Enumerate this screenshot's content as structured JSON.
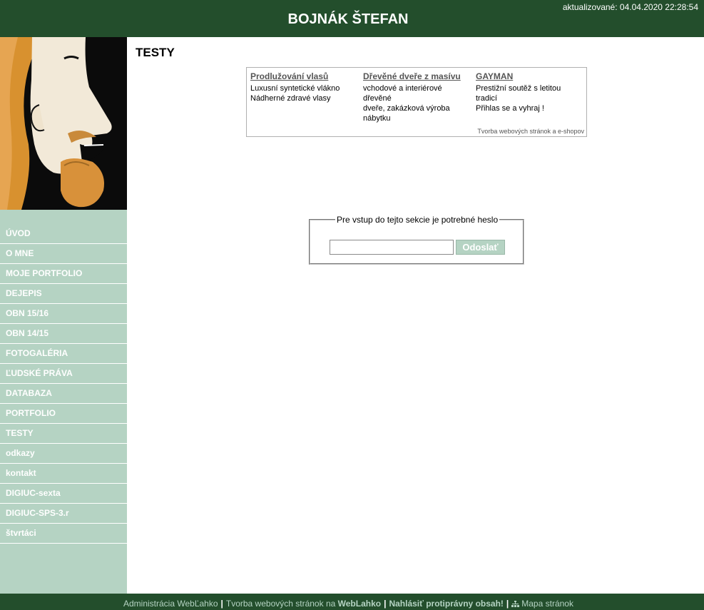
{
  "header": {
    "title": "BOJNÁK ŠTEFAN",
    "updated": "aktualizované: 04.04.2020 22:28:54"
  },
  "sidebar": {
    "items": [
      {
        "label": "ÚVOD"
      },
      {
        "label": "O MNE"
      },
      {
        "label": "MOJE PORTFOLIO"
      },
      {
        "label": "DEJEPIS"
      },
      {
        "label": "OBN 15/16"
      },
      {
        "label": "OBN 14/15"
      },
      {
        "label": "FOTOGALÉRIA"
      },
      {
        "label": "ĽUDSKÉ PRÁVA"
      },
      {
        "label": "DATABAZA"
      },
      {
        "label": "PORTFOLIO"
      },
      {
        "label": "TESTY"
      },
      {
        "label": "odkazy"
      },
      {
        "label": "kontakt"
      },
      {
        "label": "DIGIUC-sexta"
      },
      {
        "label": "DIGIUC-SPS-3.r"
      },
      {
        "label": "štvrtáci"
      }
    ]
  },
  "main": {
    "page_title": "TESTY"
  },
  "ads": {
    "items": [
      {
        "title": "Prodlužování vlasů",
        "lines": [
          "Luxusní syntetické vlákno",
          "Nádherné zdravé vlasy"
        ]
      },
      {
        "title": "Dřevěné dveře z masívu",
        "lines": [
          "vchodové a interiérové",
          "dřevěné",
          "dveře, zakázková výroba",
          "nábytku"
        ]
      },
      {
        "title": "GAYMAN",
        "lines": [
          "Prestižní soutěž s letitou",
          "tradicí",
          "Přihlas se a vyhraj !"
        ]
      }
    ],
    "footer": "Tvorba webových stránok a e-shopov"
  },
  "password": {
    "legend": "Pre vstup do tejto sekcie je potrebné heslo",
    "input_value": "",
    "button_label": "Odoslať"
  },
  "footer": {
    "admin": "Administrácia WebĽahko",
    "tvorba_prefix": "Tvorba webových stránok na",
    "tvorba_brand": "WebLahko",
    "report": "Nahlásiť protiprávny obsah!",
    "sitemap": "Mapa stránok"
  },
  "colors": {
    "header_bg": "#234e2c",
    "sidebar_bg": "#b5d3c3"
  }
}
